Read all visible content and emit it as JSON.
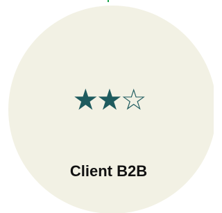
{
  "card": {
    "title": "Client B2B",
    "rating": {
      "value": 2,
      "max": 3,
      "filled_glyph": "★",
      "empty_glyph": "☆",
      "color": "#1e5b5e"
    },
    "background_color": "#f2f1e4"
  }
}
